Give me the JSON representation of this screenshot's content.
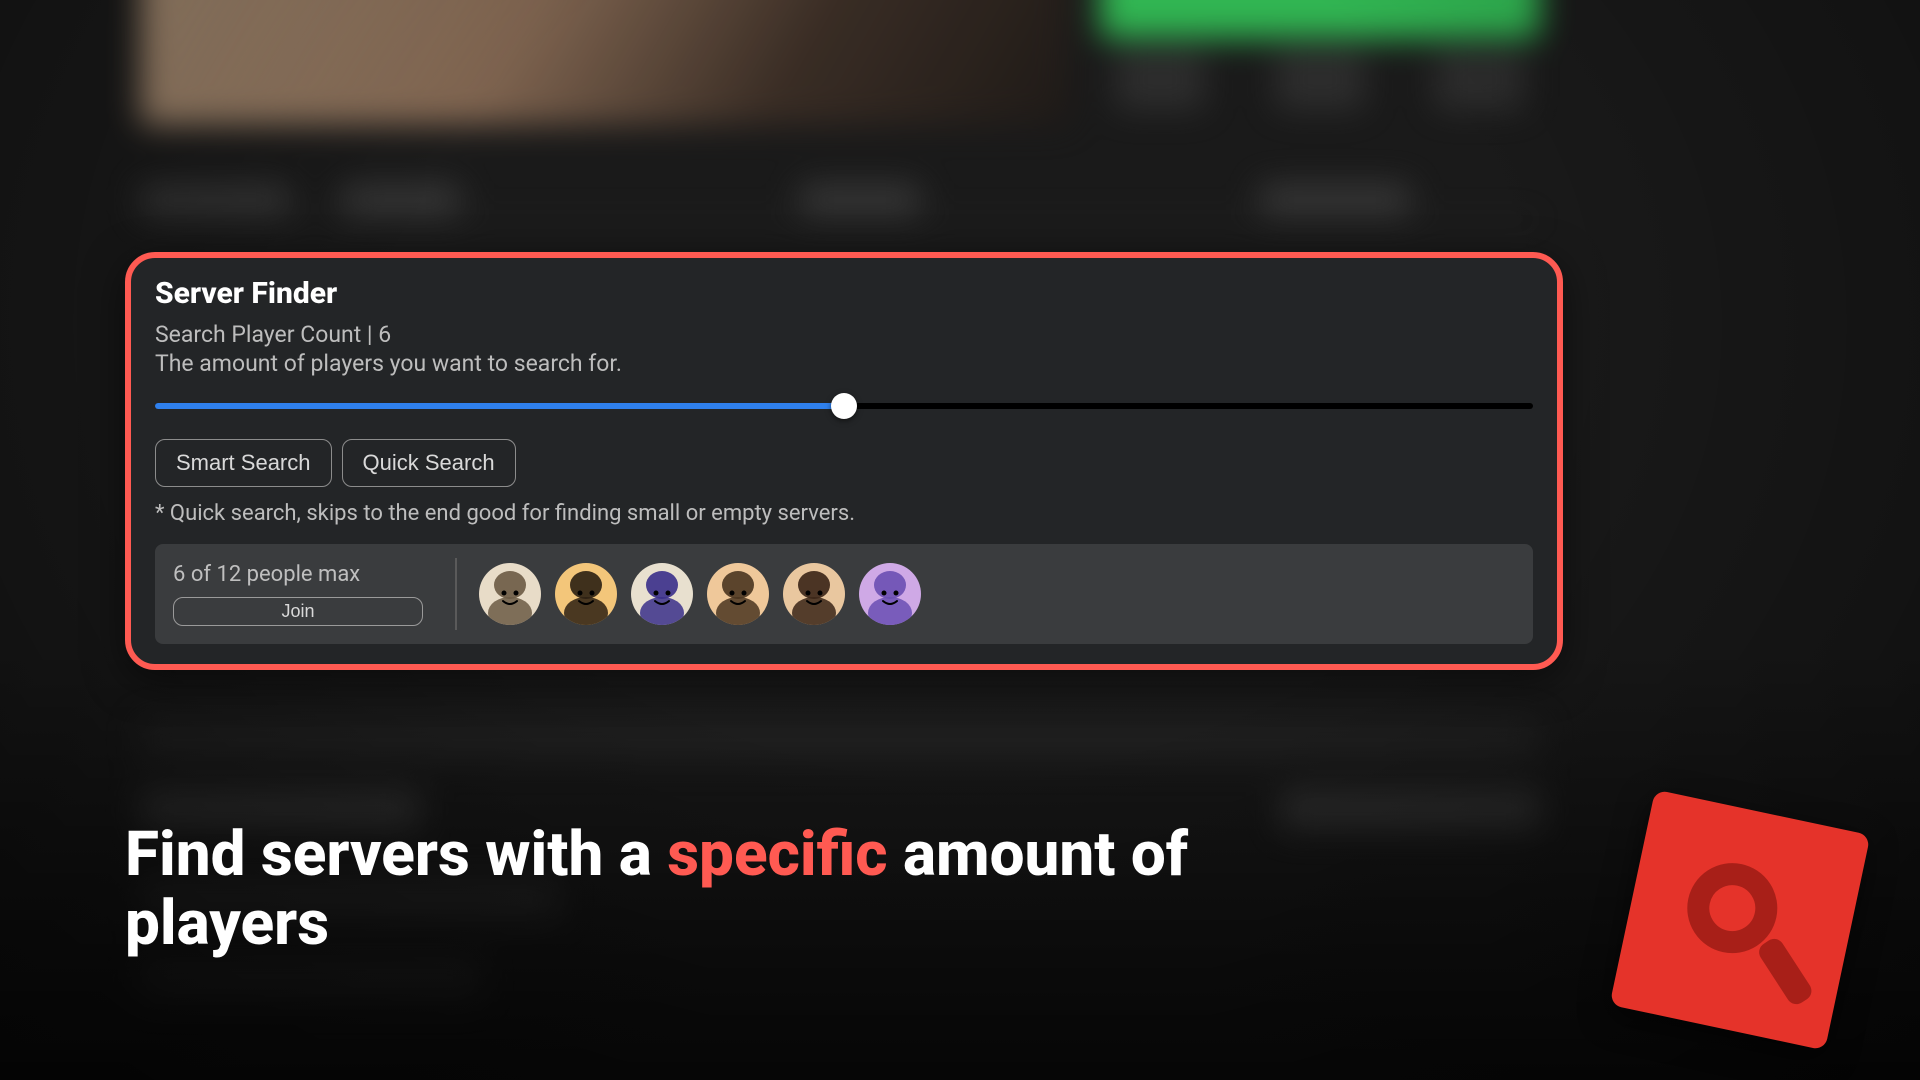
{
  "panel": {
    "title": "Server Finder",
    "count_label": "Search Player Count | 6",
    "count_value": 6,
    "count_max": 12,
    "description": "The amount of players you want to search for.",
    "slider_percent": 50,
    "buttons": {
      "smart": "Smart Search",
      "quick": "Quick Search"
    },
    "hint": "* Quick search, skips to the end good for finding small or empty servers."
  },
  "server": {
    "count_text": "6 of 12 people max",
    "join_label": "Join",
    "avatar_count": 6,
    "avatar_colors": [
      {
        "bg": "#e8dcc8",
        "face": "#6b5a44"
      },
      {
        "bg": "#f3c67a",
        "face": "#2b1f12"
      },
      {
        "bg": "#e8e0cf",
        "face": "#3a2f8a"
      },
      {
        "bg": "#efc89a",
        "face": "#4a3520"
      },
      {
        "bg": "#e9c79f",
        "face": "#3a2416"
      },
      {
        "bg": "#cfa9e6",
        "face": "#6a4fb3"
      }
    ]
  },
  "caption": {
    "pre": "Find servers with a ",
    "accent": "specific",
    "post": " amount of players"
  },
  "colors": {
    "highlight_border": "#ff5a52",
    "slider_fill": "#2f80ed"
  }
}
